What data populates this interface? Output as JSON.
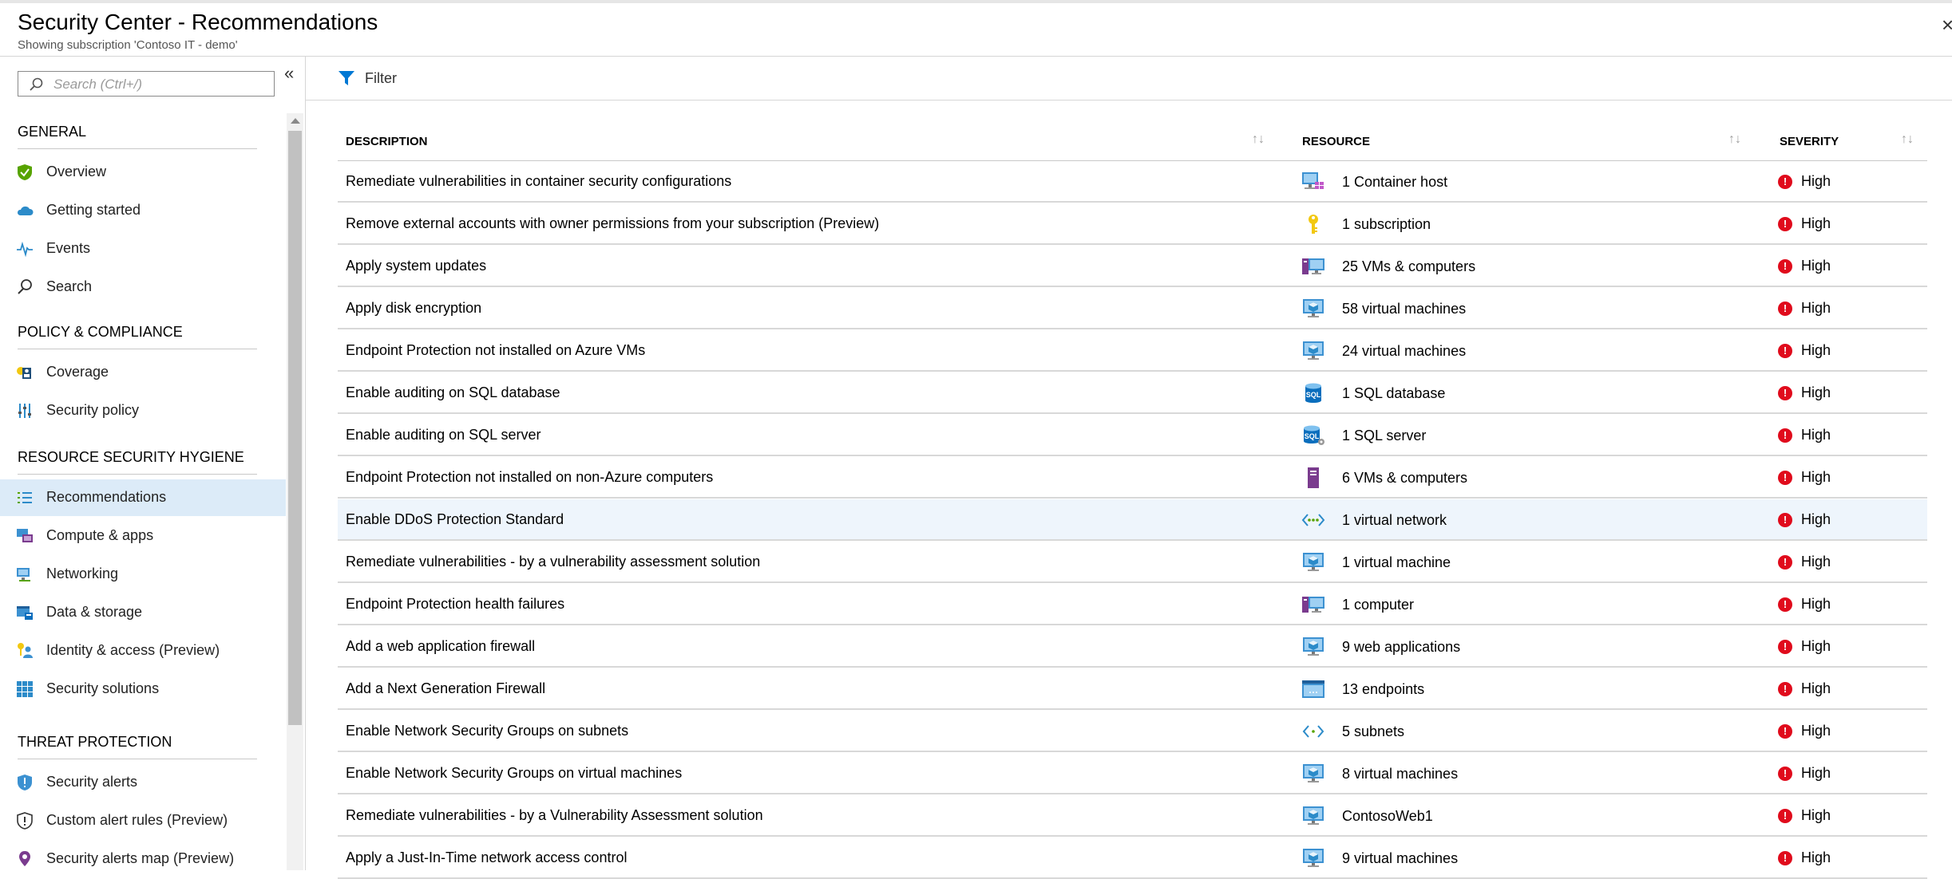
{
  "header": {
    "title": "Security Center - Recommendations",
    "subtitle": "Showing subscription 'Contoso IT - demo'",
    "close_label": "×"
  },
  "sidebar": {
    "search_placeholder": "Search (Ctrl+/)",
    "collapse_label": "«",
    "sections": [
      {
        "title": "GENERAL",
        "items": [
          {
            "label": "Overview",
            "icon": "shield-check-icon"
          },
          {
            "label": "Getting started",
            "icon": "cloud-icon"
          },
          {
            "label": "Events",
            "icon": "pulse-icon"
          },
          {
            "label": "Search",
            "icon": "search-icon"
          }
        ]
      },
      {
        "title": "POLICY & COMPLIANCE",
        "items": [
          {
            "label": "Coverage",
            "icon": "coverage-icon"
          },
          {
            "label": "Security policy",
            "icon": "sliders-icon"
          }
        ]
      },
      {
        "title": "RESOURCE SECURITY HYGIENE",
        "items": [
          {
            "label": "Recommendations",
            "icon": "list-icon",
            "selected": true
          },
          {
            "label": "Compute & apps",
            "icon": "compute-icon"
          },
          {
            "label": "Networking",
            "icon": "network-icon"
          },
          {
            "label": "Data & storage",
            "icon": "storage-icon"
          },
          {
            "label": "Identity & access (Preview)",
            "icon": "identity-icon"
          },
          {
            "label": "Security solutions",
            "icon": "grid-icon"
          }
        ]
      },
      {
        "title": "THREAT PROTECTION",
        "items": [
          {
            "label": "Security alerts",
            "icon": "alert-shield-icon"
          },
          {
            "label": "Custom alert rules (Preview)",
            "icon": "custom-rule-icon"
          },
          {
            "label": "Security alerts map (Preview)",
            "icon": "map-pin-icon"
          }
        ]
      }
    ]
  },
  "toolbar": {
    "filter_label": "Filter"
  },
  "table": {
    "columns": [
      "DESCRIPTION",
      "RESOURCE",
      "SEVERITY"
    ],
    "rows": [
      {
        "description": "Remediate vulnerabilities in container security configurations",
        "resource": "1 Container host",
        "resource_icon": "container-host-icon",
        "severity": "High"
      },
      {
        "description": "Remove external accounts with owner permissions from your subscription (Preview)",
        "resource": "1 subscription",
        "resource_icon": "key-icon",
        "severity": "High"
      },
      {
        "description": "Apply system updates",
        "resource": "25 VMs & computers",
        "resource_icon": "vms-computers-icon",
        "severity": "High"
      },
      {
        "description": "Apply disk encryption",
        "resource": "58 virtual machines",
        "resource_icon": "virtual-machine-icon",
        "severity": "High"
      },
      {
        "description": "Endpoint Protection not installed on Azure VMs",
        "resource": "24 virtual machines",
        "resource_icon": "virtual-machine-icon",
        "severity": "High"
      },
      {
        "description": "Enable auditing on SQL database",
        "resource": "1 SQL database",
        "resource_icon": "sql-database-icon",
        "severity": "High"
      },
      {
        "description": "Enable auditing on SQL server",
        "resource": "1 SQL server",
        "resource_icon": "sql-server-icon",
        "severity": "High"
      },
      {
        "description": "Endpoint Protection not installed on non-Azure computers",
        "resource": "6 VMs & computers",
        "resource_icon": "server-icon",
        "severity": "High"
      },
      {
        "description": "Enable DDoS Protection Standard",
        "resource": "1 virtual network",
        "resource_icon": "virtual-network-icon",
        "severity": "High",
        "selected": true
      },
      {
        "description": "Remediate vulnerabilities - by a vulnerability assessment solution",
        "resource": "1 virtual machine",
        "resource_icon": "virtual-machine-icon",
        "severity": "High"
      },
      {
        "description": "Endpoint Protection health failures",
        "resource": "1 computer",
        "resource_icon": "vms-computers-icon",
        "severity": "High"
      },
      {
        "description": "Add a web application firewall",
        "resource": "9 web applications",
        "resource_icon": "virtual-machine-icon",
        "severity": "High"
      },
      {
        "description": "Add a Next Generation Firewall",
        "resource": "13 endpoints",
        "resource_icon": "endpoint-icon",
        "severity": "High"
      },
      {
        "description": "Enable Network Security Groups on subnets",
        "resource": "5 subnets",
        "resource_icon": "subnet-icon",
        "severity": "High"
      },
      {
        "description": "Enable Network Security Groups on virtual machines",
        "resource": "8 virtual machines",
        "resource_icon": "virtual-machine-icon",
        "severity": "High"
      },
      {
        "description": "Remediate vulnerabilities - by a Vulnerability Assessment solution",
        "resource": "ContosoWeb1",
        "resource_icon": "virtual-machine-icon",
        "severity": "High"
      },
      {
        "description": "Apply a Just-In-Time network access control",
        "resource": "9 virtual machines",
        "resource_icon": "virtual-machine-icon",
        "severity": "High"
      }
    ]
  },
  "colors": {
    "accent": "#0078d4",
    "selected_nav": "#dcebf8",
    "selected_row": "#eef5fc",
    "severity_high": "#e00b1c"
  }
}
